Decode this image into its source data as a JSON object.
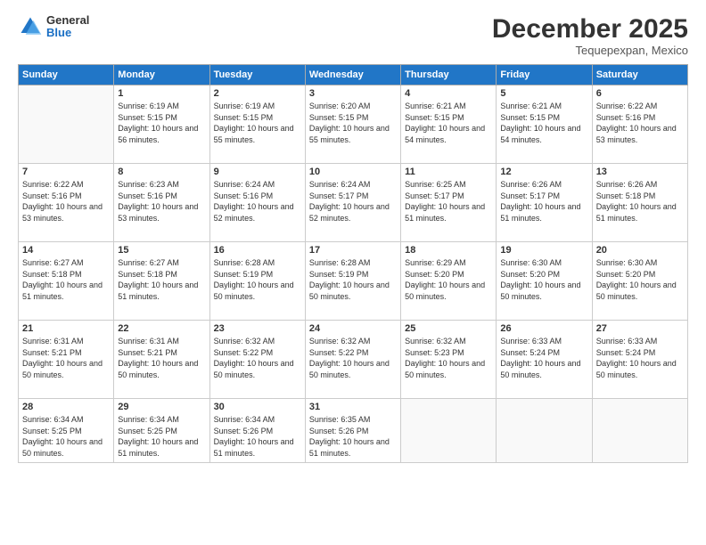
{
  "header": {
    "logo": {
      "general": "General",
      "blue": "Blue"
    },
    "title": "December 2025",
    "subtitle": "Tequepexpan, Mexico"
  },
  "calendar": {
    "days_of_week": [
      "Sunday",
      "Monday",
      "Tuesday",
      "Wednesday",
      "Thursday",
      "Friday",
      "Saturday"
    ],
    "weeks": [
      [
        {
          "day": "",
          "sunrise": "",
          "sunset": "",
          "daylight": ""
        },
        {
          "day": "1",
          "sunrise": "Sunrise: 6:19 AM",
          "sunset": "Sunset: 5:15 PM",
          "daylight": "Daylight: 10 hours and 56 minutes."
        },
        {
          "day": "2",
          "sunrise": "Sunrise: 6:19 AM",
          "sunset": "Sunset: 5:15 PM",
          "daylight": "Daylight: 10 hours and 55 minutes."
        },
        {
          "day": "3",
          "sunrise": "Sunrise: 6:20 AM",
          "sunset": "Sunset: 5:15 PM",
          "daylight": "Daylight: 10 hours and 55 minutes."
        },
        {
          "day": "4",
          "sunrise": "Sunrise: 6:21 AM",
          "sunset": "Sunset: 5:15 PM",
          "daylight": "Daylight: 10 hours and 54 minutes."
        },
        {
          "day": "5",
          "sunrise": "Sunrise: 6:21 AM",
          "sunset": "Sunset: 5:15 PM",
          "daylight": "Daylight: 10 hours and 54 minutes."
        },
        {
          "day": "6",
          "sunrise": "Sunrise: 6:22 AM",
          "sunset": "Sunset: 5:16 PM",
          "daylight": "Daylight: 10 hours and 53 minutes."
        }
      ],
      [
        {
          "day": "7",
          "sunrise": "Sunrise: 6:22 AM",
          "sunset": "Sunset: 5:16 PM",
          "daylight": "Daylight: 10 hours and 53 minutes."
        },
        {
          "day": "8",
          "sunrise": "Sunrise: 6:23 AM",
          "sunset": "Sunset: 5:16 PM",
          "daylight": "Daylight: 10 hours and 53 minutes."
        },
        {
          "day": "9",
          "sunrise": "Sunrise: 6:24 AM",
          "sunset": "Sunset: 5:16 PM",
          "daylight": "Daylight: 10 hours and 52 minutes."
        },
        {
          "day": "10",
          "sunrise": "Sunrise: 6:24 AM",
          "sunset": "Sunset: 5:17 PM",
          "daylight": "Daylight: 10 hours and 52 minutes."
        },
        {
          "day": "11",
          "sunrise": "Sunrise: 6:25 AM",
          "sunset": "Sunset: 5:17 PM",
          "daylight": "Daylight: 10 hours and 51 minutes."
        },
        {
          "day": "12",
          "sunrise": "Sunrise: 6:26 AM",
          "sunset": "Sunset: 5:17 PM",
          "daylight": "Daylight: 10 hours and 51 minutes."
        },
        {
          "day": "13",
          "sunrise": "Sunrise: 6:26 AM",
          "sunset": "Sunset: 5:18 PM",
          "daylight": "Daylight: 10 hours and 51 minutes."
        }
      ],
      [
        {
          "day": "14",
          "sunrise": "Sunrise: 6:27 AM",
          "sunset": "Sunset: 5:18 PM",
          "daylight": "Daylight: 10 hours and 51 minutes."
        },
        {
          "day": "15",
          "sunrise": "Sunrise: 6:27 AM",
          "sunset": "Sunset: 5:18 PM",
          "daylight": "Daylight: 10 hours and 51 minutes."
        },
        {
          "day": "16",
          "sunrise": "Sunrise: 6:28 AM",
          "sunset": "Sunset: 5:19 PM",
          "daylight": "Daylight: 10 hours and 50 minutes."
        },
        {
          "day": "17",
          "sunrise": "Sunrise: 6:28 AM",
          "sunset": "Sunset: 5:19 PM",
          "daylight": "Daylight: 10 hours and 50 minutes."
        },
        {
          "day": "18",
          "sunrise": "Sunrise: 6:29 AM",
          "sunset": "Sunset: 5:20 PM",
          "daylight": "Daylight: 10 hours and 50 minutes."
        },
        {
          "day": "19",
          "sunrise": "Sunrise: 6:30 AM",
          "sunset": "Sunset: 5:20 PM",
          "daylight": "Daylight: 10 hours and 50 minutes."
        },
        {
          "day": "20",
          "sunrise": "Sunrise: 6:30 AM",
          "sunset": "Sunset: 5:20 PM",
          "daylight": "Daylight: 10 hours and 50 minutes."
        }
      ],
      [
        {
          "day": "21",
          "sunrise": "Sunrise: 6:31 AM",
          "sunset": "Sunset: 5:21 PM",
          "daylight": "Daylight: 10 hours and 50 minutes."
        },
        {
          "day": "22",
          "sunrise": "Sunrise: 6:31 AM",
          "sunset": "Sunset: 5:21 PM",
          "daylight": "Daylight: 10 hours and 50 minutes."
        },
        {
          "day": "23",
          "sunrise": "Sunrise: 6:32 AM",
          "sunset": "Sunset: 5:22 PM",
          "daylight": "Daylight: 10 hours and 50 minutes."
        },
        {
          "day": "24",
          "sunrise": "Sunrise: 6:32 AM",
          "sunset": "Sunset: 5:22 PM",
          "daylight": "Daylight: 10 hours and 50 minutes."
        },
        {
          "day": "25",
          "sunrise": "Sunrise: 6:32 AM",
          "sunset": "Sunset: 5:23 PM",
          "daylight": "Daylight: 10 hours and 50 minutes."
        },
        {
          "day": "26",
          "sunrise": "Sunrise: 6:33 AM",
          "sunset": "Sunset: 5:24 PM",
          "daylight": "Daylight: 10 hours and 50 minutes."
        },
        {
          "day": "27",
          "sunrise": "Sunrise: 6:33 AM",
          "sunset": "Sunset: 5:24 PM",
          "daylight": "Daylight: 10 hours and 50 minutes."
        }
      ],
      [
        {
          "day": "28",
          "sunrise": "Sunrise: 6:34 AM",
          "sunset": "Sunset: 5:25 PM",
          "daylight": "Daylight: 10 hours and 50 minutes."
        },
        {
          "day": "29",
          "sunrise": "Sunrise: 6:34 AM",
          "sunset": "Sunset: 5:25 PM",
          "daylight": "Daylight: 10 hours and 51 minutes."
        },
        {
          "day": "30",
          "sunrise": "Sunrise: 6:34 AM",
          "sunset": "Sunset: 5:26 PM",
          "daylight": "Daylight: 10 hours and 51 minutes."
        },
        {
          "day": "31",
          "sunrise": "Sunrise: 6:35 AM",
          "sunset": "Sunset: 5:26 PM",
          "daylight": "Daylight: 10 hours and 51 minutes."
        },
        {
          "day": "",
          "sunrise": "",
          "sunset": "",
          "daylight": ""
        },
        {
          "day": "",
          "sunrise": "",
          "sunset": "",
          "daylight": ""
        },
        {
          "day": "",
          "sunrise": "",
          "sunset": "",
          "daylight": ""
        }
      ]
    ]
  }
}
